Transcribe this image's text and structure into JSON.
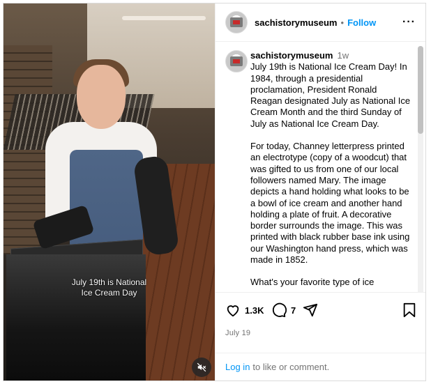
{
  "media": {
    "caption": "July 19th is National\nIce Cream Day",
    "mute_icon": "speaker-muted-icon"
  },
  "header": {
    "username": "sachistorymuseum",
    "separator": "•",
    "follow_label": "Follow",
    "more_label": "···"
  },
  "comment": {
    "username": "sachistorymuseum",
    "age": "1w",
    "paragraphs": [
      "July 19th is National Ice Cream Day! In 1984, through a presidential proclamation, President Ronald Reagan designated July as National Ice Cream Month and the third Sunday of July as National Ice Cream Day.",
      "For today, Channey letterpress printed an electrotype (copy of a woodcut) that was gifted to us from one of our local followers named Mary. The image depicts a hand holding what looks to be a bowl of ice cream and another hand holding a plate of fruit. A decorative border surrounds the image. This was printed with black rubber base ink using our Washington hand press, which was made in 1852.",
      "What's your favorite type of ice"
    ]
  },
  "actions": {
    "likes": "1.3K",
    "comments": "7",
    "icons": [
      "heart-icon",
      "comment-icon",
      "share-icon",
      "bookmark-icon"
    ]
  },
  "date": "July 19",
  "login": {
    "link_label": "Log in",
    "suffix": "to like or comment."
  },
  "colors": {
    "accent": "#0095f6",
    "muted_text": "#737373",
    "border": "#dbdbdb"
  }
}
